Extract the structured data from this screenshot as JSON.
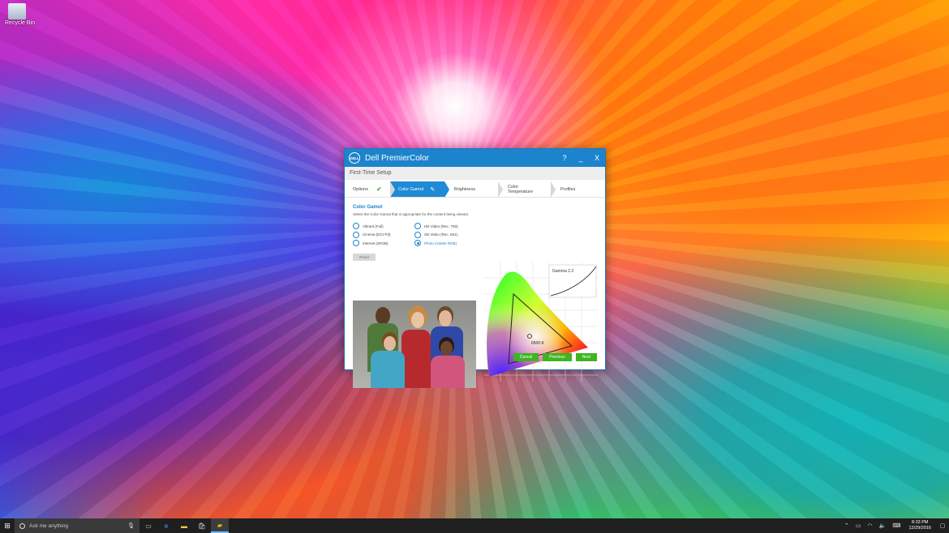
{
  "desktop": {
    "recycle_bin_label": "Recycle Bin"
  },
  "window": {
    "title": "Dell PremierColor",
    "controls": {
      "help": "?",
      "minimize": "_",
      "close": "X"
    },
    "subtitle": "First-Time Setup",
    "steps": [
      {
        "label": "Options"
      },
      {
        "label": "Color Gamut"
      },
      {
        "label": "Brightness"
      },
      {
        "label": "Color Temperature"
      },
      {
        "label": "Profiles"
      }
    ],
    "section_title": "Color Gamut",
    "section_desc": "Select the Color Gamut that is appropriate for the content being viewed.",
    "options_left": [
      "Vibrant (Full)",
      "Cinema (DCI-P3)",
      "Internet (sRGB)"
    ],
    "options_right": [
      "HD Video (Rec. 709)",
      "SD Video (Rec. 601)",
      "Photo (Adobe RGB)"
    ],
    "selected_option": "Photo (Adobe RGB)",
    "reset_label": "Reset",
    "gamut_chart": {
      "gamma_label": "Gamma 2.2",
      "whitepoint_label": "6500 K"
    },
    "buttons": {
      "cancel": "Cancel",
      "previous": "Previous",
      "next": "Next"
    },
    "accent_color": "#1b84cc",
    "button_color": "#3cb521"
  },
  "taskbar": {
    "search_placeholder": "Ask me anything",
    "time": "8:33 PM",
    "date": "12/29/2016"
  }
}
